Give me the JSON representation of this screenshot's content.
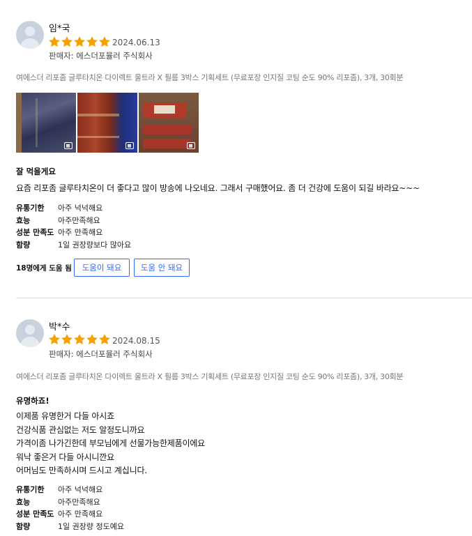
{
  "colors": {
    "star": "#f5a100",
    "accent": "#346aff"
  },
  "reviews": [
    {
      "author": "임*국",
      "rating": 5,
      "date": "2024.06.13",
      "seller": "판매자: 에스더포뮬러 주식회사",
      "product": "여에스더 리포좀 글루타치온 다이렉트 울트라 X 필름 3박스 기획세트 (무료포장 인지질 코팅 순도 90% 리포좀), 3개, 30회분",
      "headline": "잘 먹을게요",
      "body": [
        "요즘 리포좀 글루타치온이 더 좋다고 많이 방송에 나오네요. 그래서 구매했어요. 좀 더 건강에 도움이 되길 바라요~~~"
      ],
      "survey": [
        {
          "q": "유통기한",
          "a": "아주 넉넉해요"
        },
        {
          "q": "효능",
          "a": "아주만족해요"
        },
        {
          "q": "성분 만족도",
          "a": "아주 만족해요"
        },
        {
          "q": "함량",
          "a": "1일 권장량보다 많아요"
        }
      ],
      "helpful_count": "18명에게 도움 됨",
      "helpful_yes": "도움이 돼요",
      "helpful_no": "도움 안 돼요"
    },
    {
      "author": "박*수",
      "rating": 5,
      "date": "2024.08.15",
      "seller": "판매자: 에스더포뮬러 주식회사",
      "product": "여에스더 리포좀 글루타치온 다이렉트 울트라 X 필름 3박스 기획세트 (무료포장 인지질 코팅 순도 90% 리포좀), 3개, 30회분",
      "headline": "유명하죠!",
      "body": [
        "이제품 유명한거 다들 아시죠",
        "건강식품 관심없는 저도 알정도니까요",
        "가격이좀 나가긴한데 부모님에게 선물가능한제품이에요",
        "워낙 좋은거 다들 아시니깐요",
        "어머님도 만족하시며 드시고 계십니다."
      ],
      "survey": [
        {
          "q": "유통기한",
          "a": "아주 넉넉해요"
        },
        {
          "q": "효능",
          "a": "아주만족해요"
        },
        {
          "q": "성분 만족도",
          "a": "아주 만족해요"
        },
        {
          "q": "함량",
          "a": "1일 권장량 정도예요"
        }
      ]
    }
  ]
}
